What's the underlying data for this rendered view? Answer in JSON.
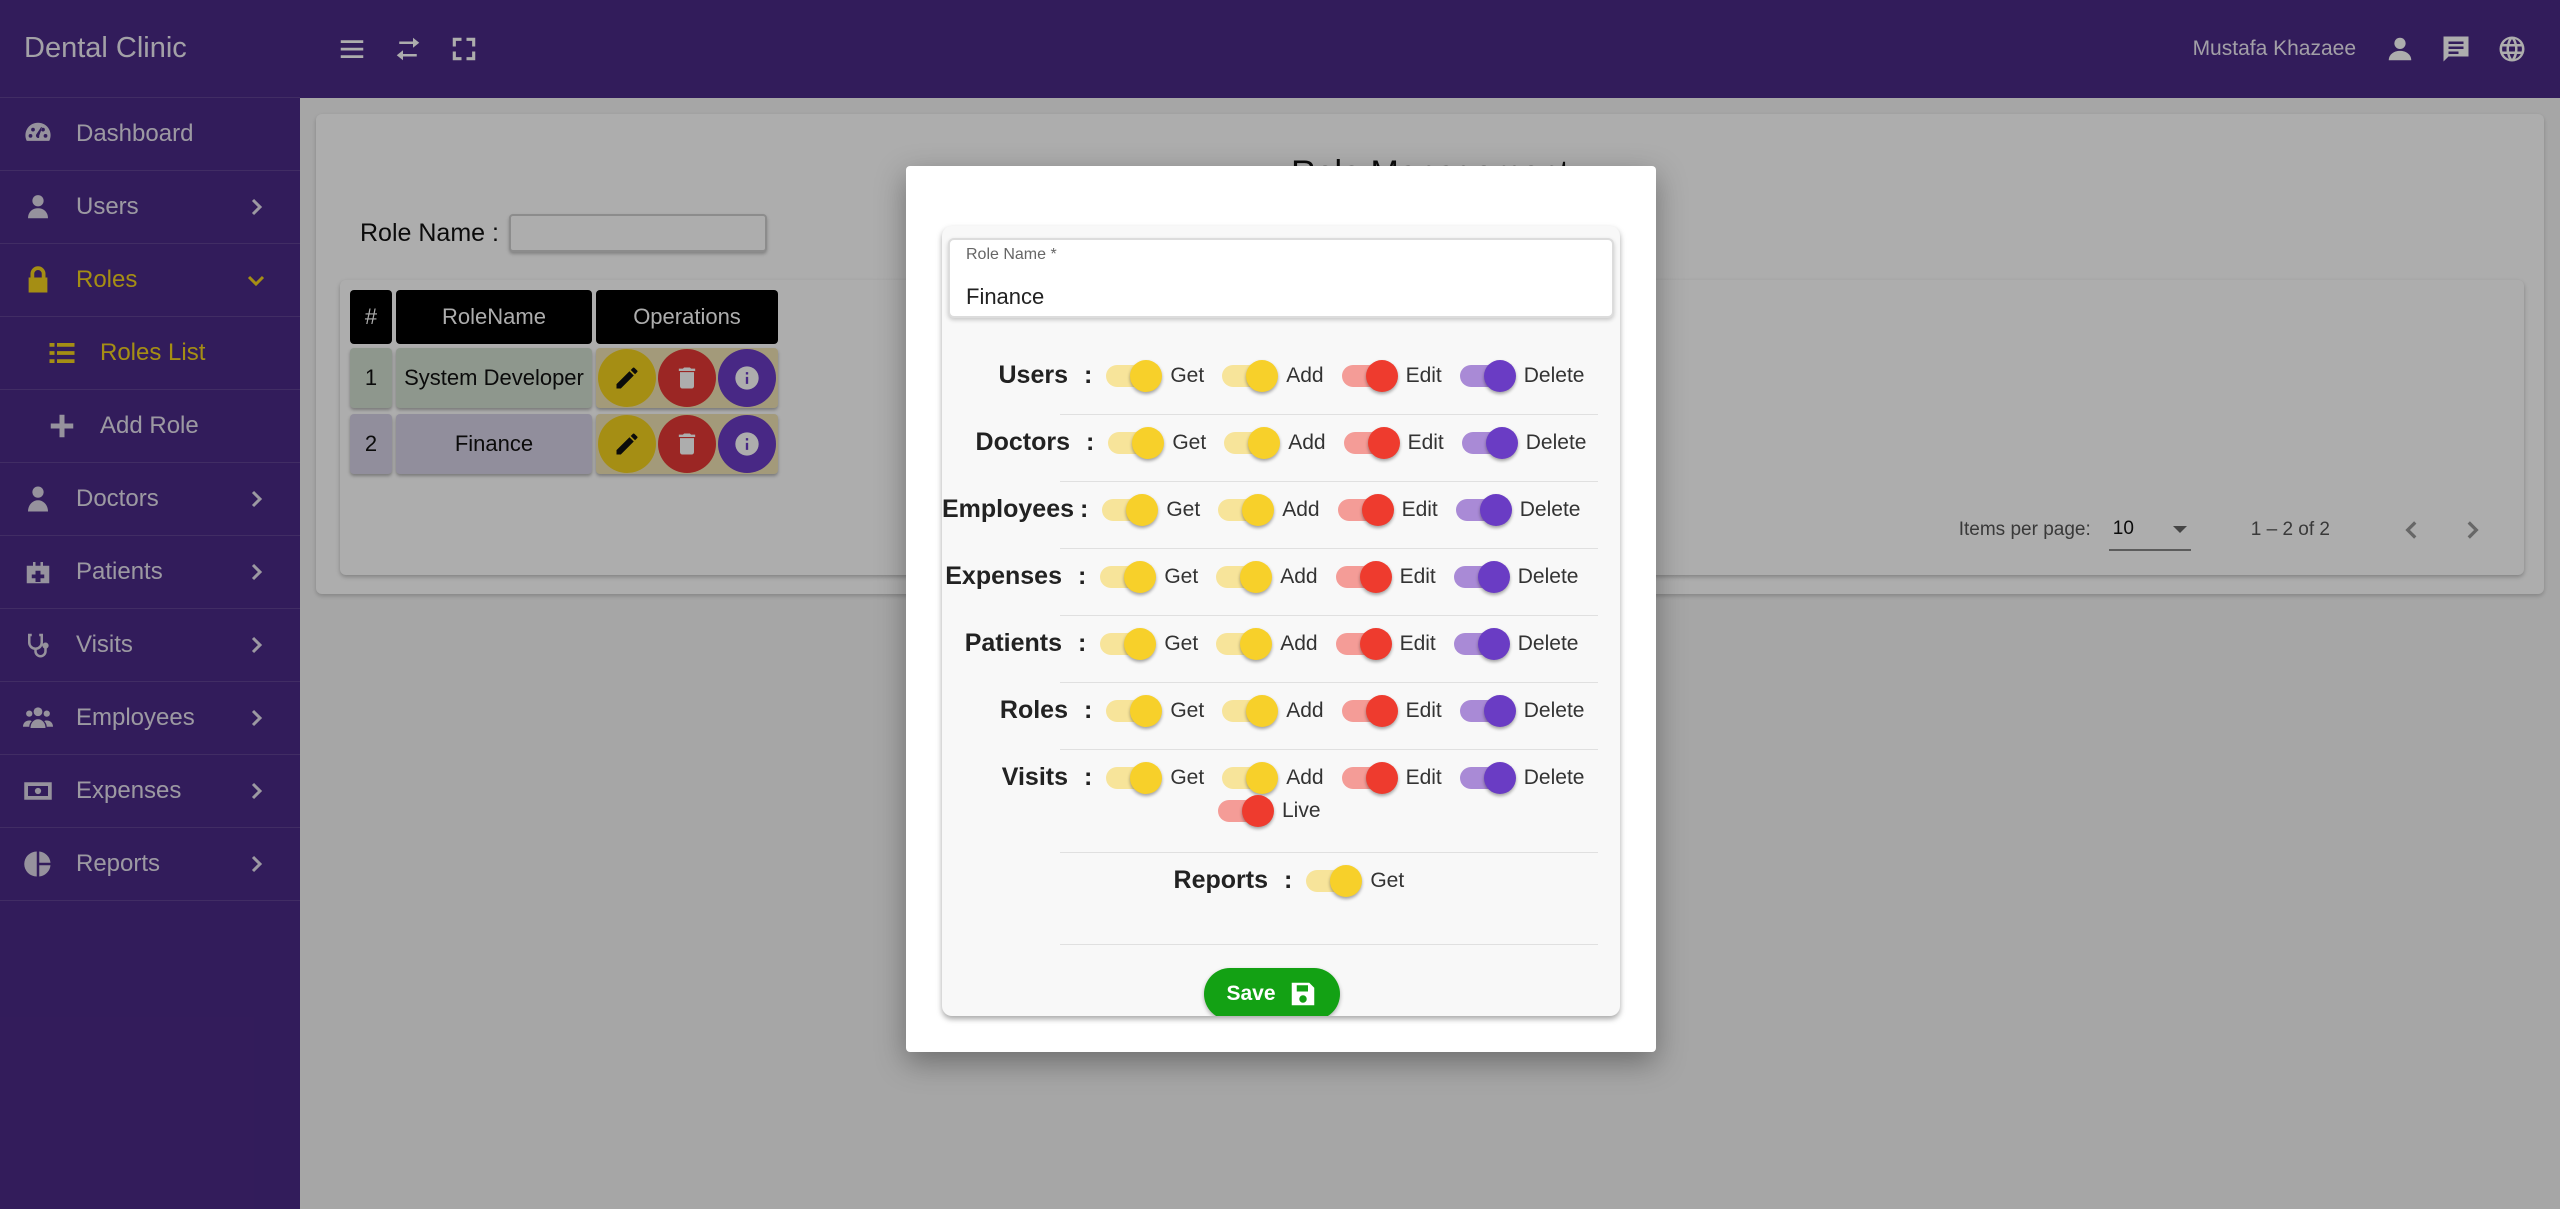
{
  "app": {
    "title": "Dental Clinic"
  },
  "sidebar": {
    "items": [
      {
        "label": "Dashboard",
        "icon": "dashboard-icon"
      },
      {
        "label": "Users",
        "icon": "user-icon"
      },
      {
        "label": "Roles",
        "icon": "lock-icon"
      },
      {
        "label": "Roles List",
        "icon": "list-icon"
      },
      {
        "label": "Add Role",
        "icon": "plus-icon"
      },
      {
        "label": "Doctors",
        "icon": "doctor-icon"
      },
      {
        "label": "Patients",
        "icon": "medical-kit-icon"
      },
      {
        "label": "Visits",
        "icon": "stethoscope-icon"
      },
      {
        "label": "Employees",
        "icon": "group-icon"
      },
      {
        "label": "Expenses",
        "icon": "money-icon"
      },
      {
        "label": "Reports",
        "icon": "pie-chart-icon"
      }
    ]
  },
  "topbar": {
    "user_name": "Mustafa Khazaee"
  },
  "page": {
    "title": "Role Management",
    "filter_label": "Role Name :"
  },
  "table": {
    "headers": [
      "#",
      "RoleName",
      "Operations"
    ],
    "rows": [
      {
        "num": "1",
        "name": "System Developer"
      },
      {
        "num": "2",
        "name": "Finance"
      }
    ]
  },
  "paginator": {
    "items_per_page_label": "Items per page:",
    "page_size": "10",
    "range": "1 – 2 of 2"
  },
  "dialog": {
    "field_label": "Role Name *",
    "field_value": "Finance",
    "permissions": [
      {
        "label": "Users",
        "toggles": [
          "Get",
          "Add",
          "Edit",
          "Delete"
        ]
      },
      {
        "label": "Doctors",
        "toggles": [
          "Get",
          "Add",
          "Edit",
          "Delete"
        ]
      },
      {
        "label": "Employees",
        "toggles": [
          "Get",
          "Add",
          "Edit",
          "Delete"
        ]
      },
      {
        "label": "Expenses",
        "toggles": [
          "Get",
          "Add",
          "Edit",
          "Delete"
        ]
      },
      {
        "label": "Patients",
        "toggles": [
          "Get",
          "Add",
          "Edit",
          "Delete"
        ]
      },
      {
        "label": "Roles",
        "toggles": [
          "Get",
          "Add",
          "Edit",
          "Delete"
        ]
      },
      {
        "label": "Visits",
        "toggles": [
          "Get",
          "Add",
          "Edit",
          "Delete",
          "Live"
        ]
      },
      {
        "label": "Reports",
        "toggles": [
          "Get"
        ]
      }
    ],
    "colon": ":",
    "save_label": "Save"
  },
  "colors": {
    "primary": "#4b2a86",
    "accent": "#f3d21e",
    "danger": "#ee3b2e",
    "purple": "#6a3cc4",
    "save": "#13a114"
  }
}
